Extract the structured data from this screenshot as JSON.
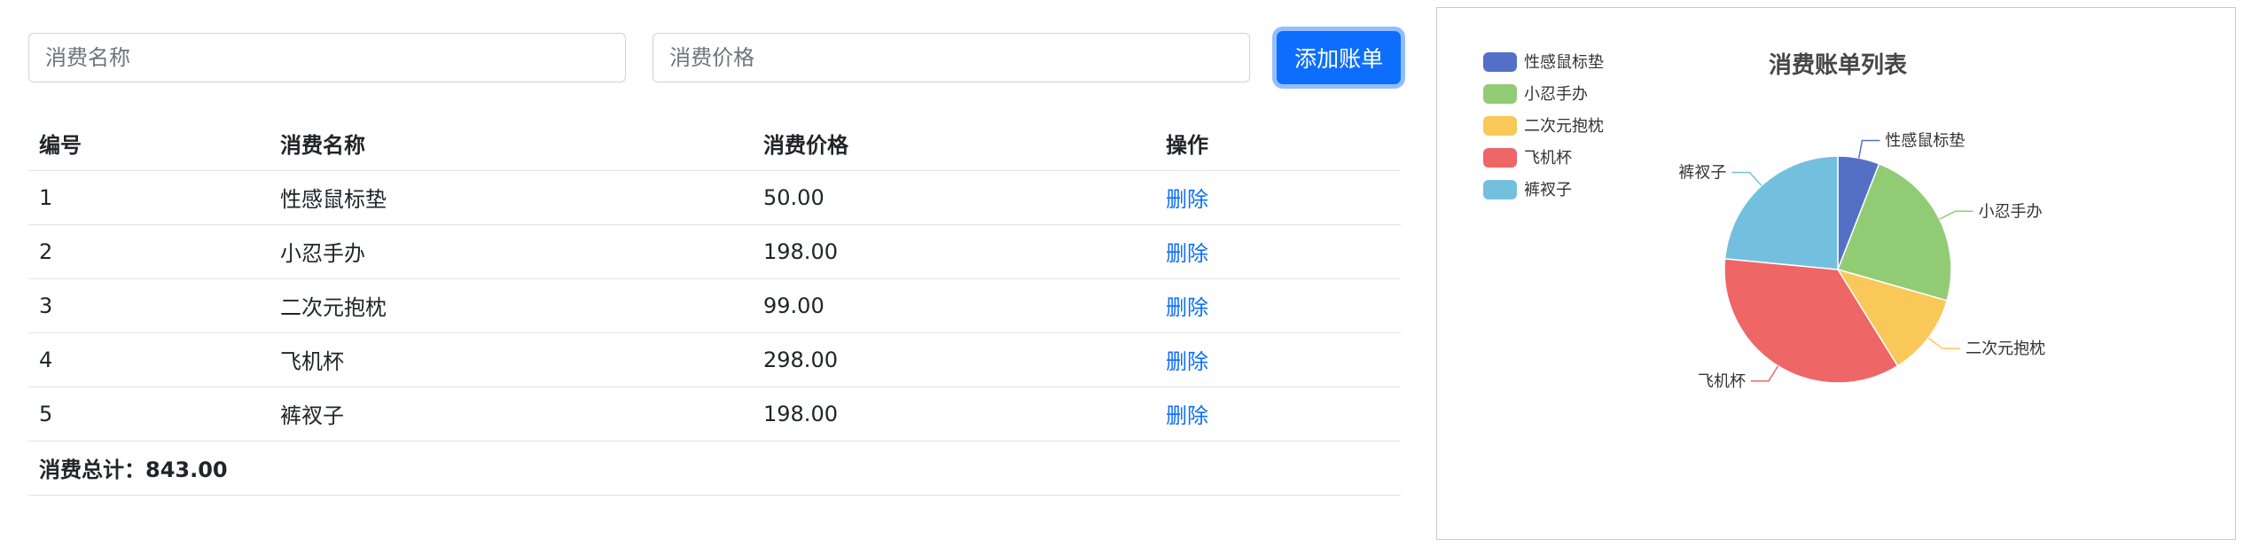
{
  "form": {
    "name_placeholder": "消费名称",
    "price_placeholder": "消费价格",
    "add_button": "添加账单"
  },
  "table": {
    "headers": [
      "编号",
      "消费名称",
      "消费价格",
      "操作"
    ],
    "rows": [
      {
        "id": "1",
        "name": "性感鼠标垫",
        "price": "50.00",
        "action": "删除"
      },
      {
        "id": "2",
        "name": "小忍手办",
        "price": "198.00",
        "action": "删除"
      },
      {
        "id": "3",
        "name": "二次元抱枕",
        "price": "99.00",
        "action": "删除"
      },
      {
        "id": "4",
        "name": "飞机杯",
        "price": "298.00",
        "action": "删除"
      },
      {
        "id": "5",
        "name": "裤衩子",
        "price": "198.00",
        "action": "删除"
      }
    ],
    "total_label": "消费总计：",
    "total_value": "843.00"
  },
  "chart_data": {
    "type": "pie",
    "title": "消费账单列表",
    "legend_position": "top-left",
    "categories": [
      "性感鼠标垫",
      "小忍手办",
      "二次元抱枕",
      "飞机杯",
      "裤衩子"
    ],
    "values": [
      50,
      198,
      99,
      298,
      198
    ],
    "colors": [
      "#5470c6",
      "#91cc75",
      "#fac858",
      "#ee6666",
      "#73c0de"
    ]
  }
}
